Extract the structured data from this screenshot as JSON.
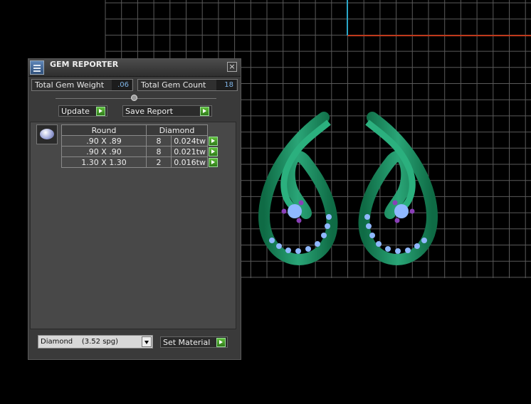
{
  "panel": {
    "title": "GEM REPORTER",
    "close_label": "×",
    "total_weight_label": "Total Gem Weight",
    "total_weight_value": ".06",
    "total_count_label": "Total Gem Count",
    "total_count_value": "18",
    "update_label": "Update",
    "save_report_label": "Save Report",
    "table": {
      "headers": [
        "Round",
        "Diamond"
      ],
      "rows": [
        {
          "size": ".90 X .89",
          "count": "8",
          "weight": "0.024tw"
        },
        {
          "size": ".90 X .90",
          "count": "8",
          "weight": "0.021tw"
        },
        {
          "size": "1.30 X 1.30",
          "count": "2",
          "weight": "0.016tw"
        }
      ]
    },
    "material_select": "Diamond    (3.52 spg)",
    "set_material_label": "Set Material"
  },
  "viewport": {
    "grid_color": "#5a5a5a",
    "metal_color": "#1f8a5c",
    "gem_color": "#8fb8ff",
    "prong_color": "#8a3fb8",
    "axis_red": "#c0391b",
    "axis_cyan": "#2aa8c8"
  }
}
